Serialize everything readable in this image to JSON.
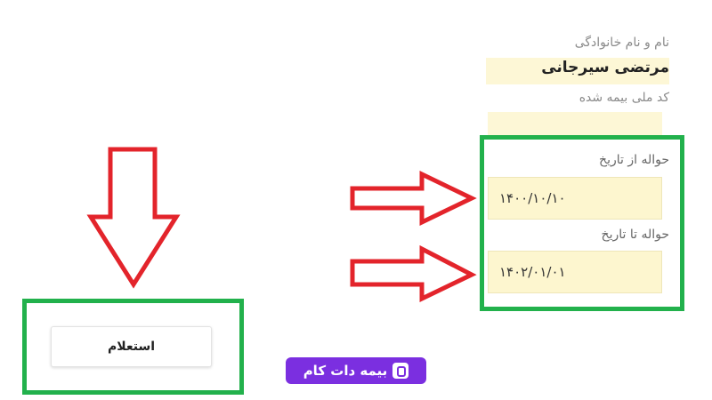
{
  "form": {
    "name_label": "نام و نام خانوادگی",
    "name_value": "مرتضی سیرجانی",
    "national_code_label": "کد ملی بیمه شده",
    "national_code_value": "",
    "from_date_label": "حواله از تاریخ",
    "from_date_value": "۱۴۰۰/۱۰/۱۰",
    "to_date_label": "حواله تا تاریخ",
    "to_date_value": "۱۴۰۲/۰۱/۰۱"
  },
  "actions": {
    "inquiry_label": "استعلام"
  },
  "watermark": {
    "logo_text": "بیمه دات کام"
  },
  "colors": {
    "highlight_green": "#22b14c",
    "arrow_red": "#e3242b",
    "field_yellow": "#fdf6cf",
    "logo_purple": "#7b2fe0"
  }
}
